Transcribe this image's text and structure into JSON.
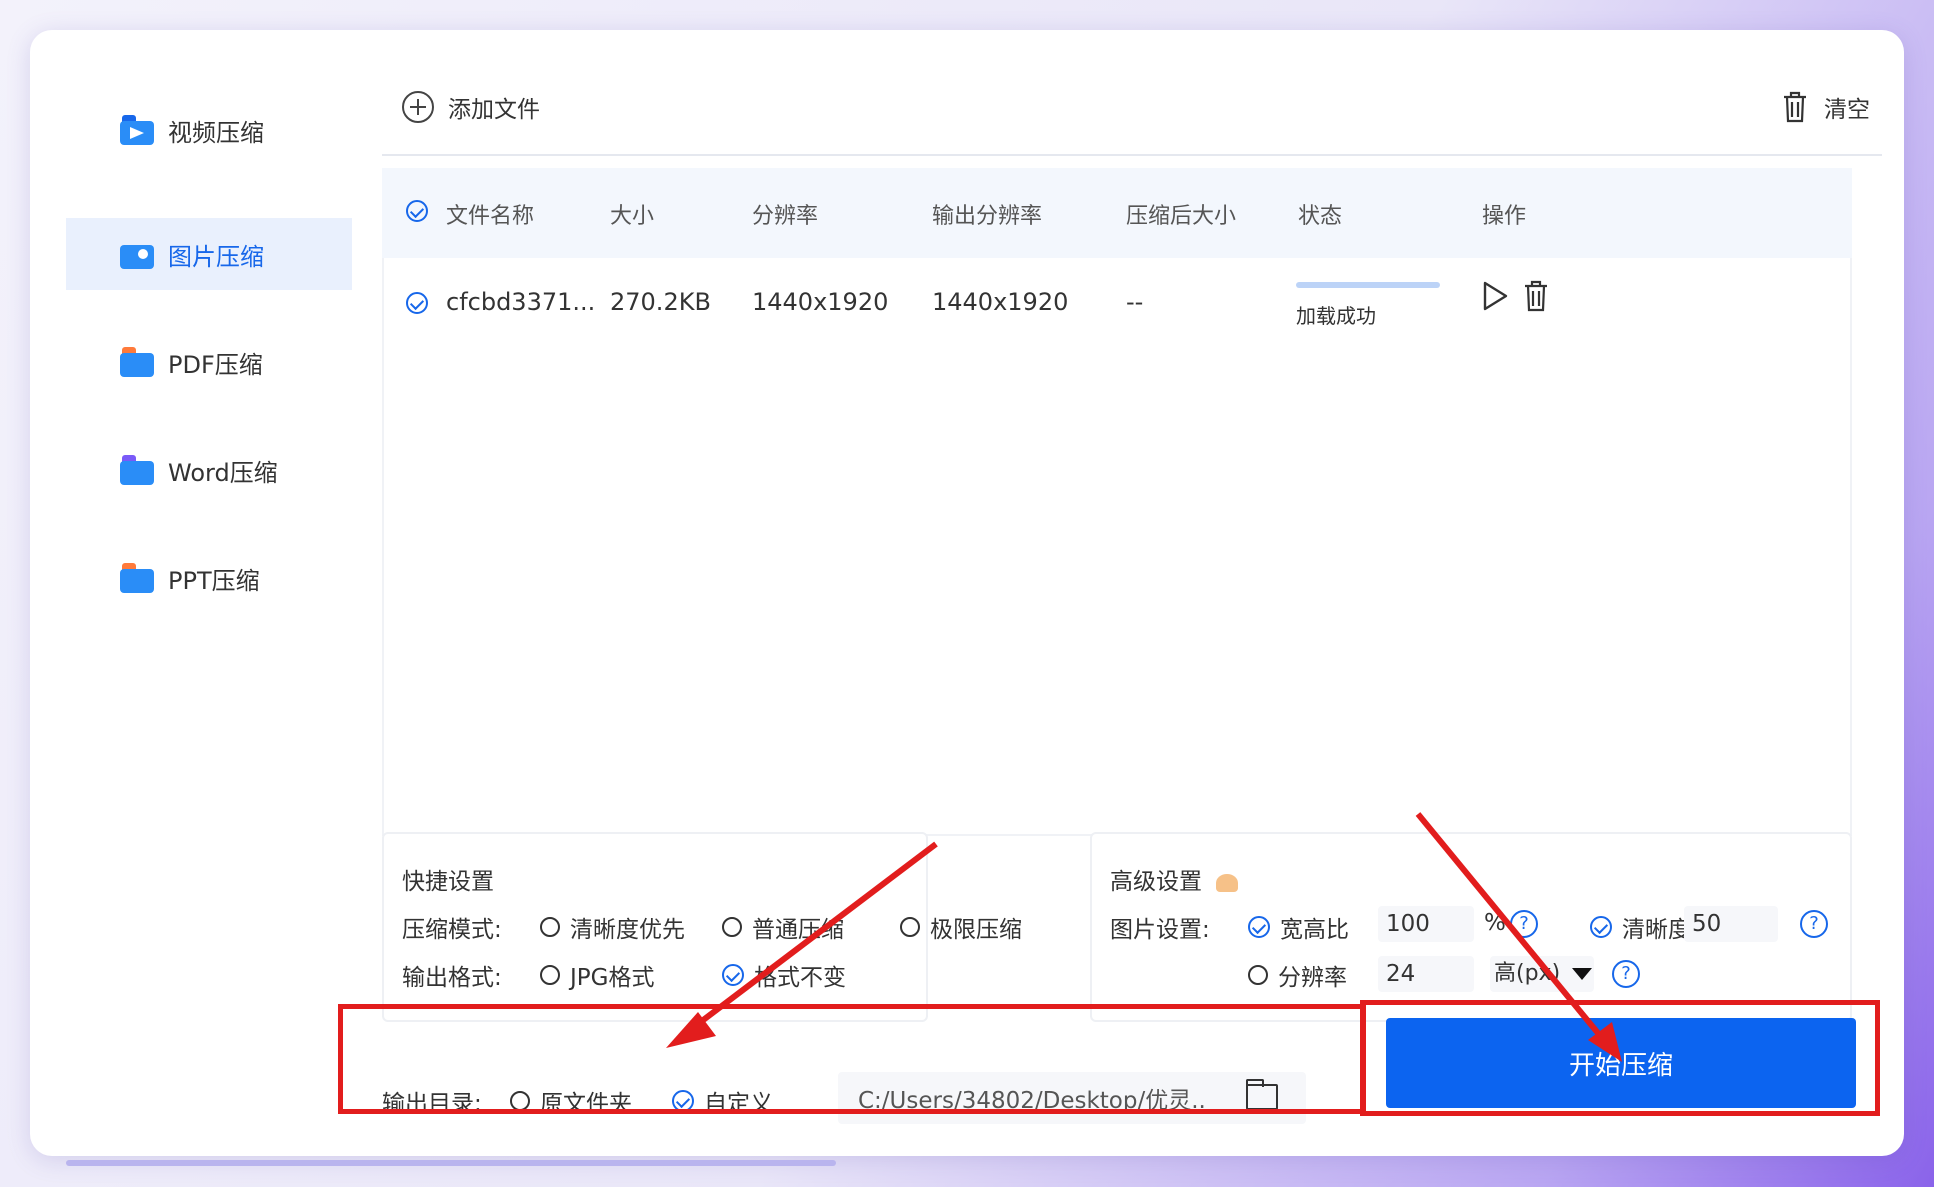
{
  "sidebar": {
    "items": [
      {
        "label": "视频压缩",
        "icon": "video-compress-icon"
      },
      {
        "label": "图片压缩",
        "icon": "image-compress-icon",
        "active": true
      },
      {
        "label": "PDF压缩",
        "icon": "pdf-compress-icon"
      },
      {
        "label": "Word压缩",
        "icon": "word-compress-icon"
      },
      {
        "label": "PPT压缩",
        "icon": "ppt-compress-icon"
      }
    ]
  },
  "toolbar": {
    "add_label": "添加文件",
    "clear_label": "清空"
  },
  "table": {
    "columns": [
      "文件名称",
      "大小",
      "分辨率",
      "输出分辨率",
      "压缩后大小",
      "状态",
      "操作"
    ],
    "rows": [
      {
        "name": "cfcbd3371...",
        "size": "270.2KB",
        "resolution": "1440x1920",
        "output_resolution": "1440x1920",
        "compressed_size": "--",
        "status": "加载成功",
        "progress": 1.0
      }
    ]
  },
  "quick": {
    "title": "快捷设置",
    "mode_label": "压缩模式:",
    "modes": [
      "清晰度优先",
      "普通压缩",
      "极限压缩"
    ],
    "format_label": "输出格式:",
    "formats": [
      "JPG格式",
      "格式不变"
    ],
    "selected_format": "格式不变"
  },
  "advanced": {
    "title": "高级设置",
    "image_label": "图片设置:",
    "aspect_label": "宽高比",
    "aspect_value": "100",
    "aspect_unit": "%",
    "clarity_label": "清晰度",
    "clarity_value": "50",
    "resolution_label": "分辨率",
    "resolution_value": "24",
    "resolution_unit": "高(px)",
    "help_glyph": "?"
  },
  "output": {
    "label": "输出目录:",
    "options": [
      "原文件夹",
      "自定义"
    ],
    "selected": "自定义",
    "path": "C:/Users/34802/Desktop/优灵.."
  },
  "start_label": "开始压缩",
  "colors": {
    "accent": "#0c64f0",
    "annotation": "#e21d1d",
    "active_bg": "#e9f0fd"
  }
}
